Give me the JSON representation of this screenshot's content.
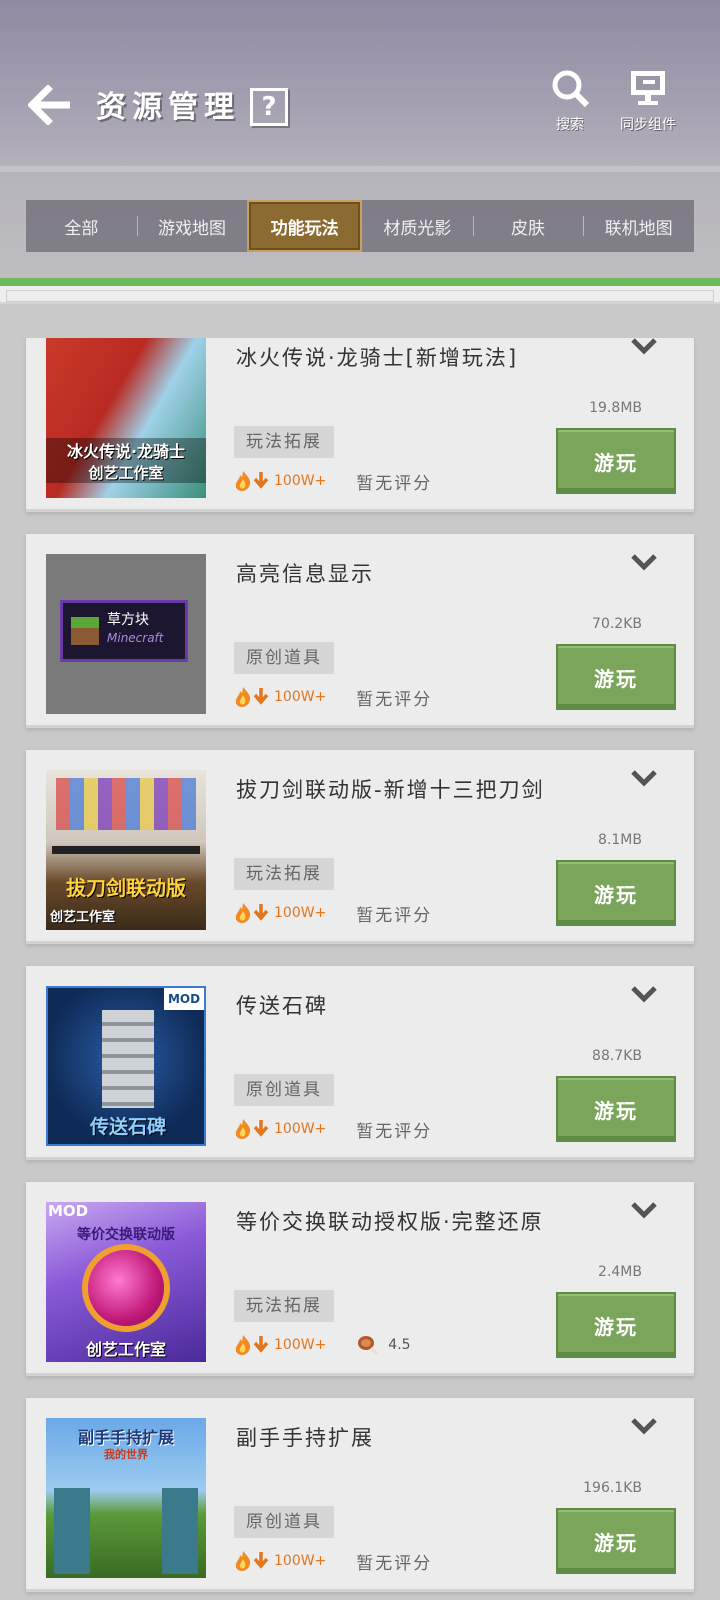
{
  "header": {
    "title": "资源管理",
    "help_label": "?",
    "search_label": "搜索",
    "sync_label": "同步组件"
  },
  "tabs": [
    {
      "label": "全部",
      "active": false
    },
    {
      "label": "游戏地图",
      "active": false
    },
    {
      "label": "功能玩法",
      "active": true
    },
    {
      "label": "材质光影",
      "active": false
    },
    {
      "label": "皮肤",
      "active": false
    },
    {
      "label": "联机地图",
      "active": false
    }
  ],
  "items": [
    {
      "title": "冰火传说·龙骑士[新增玩法]",
      "size": "19.8MB",
      "tag": "玩法拓展",
      "downloads": "100W+",
      "rating": "暂无评分",
      "play_label": "游玩",
      "thumb_lines": [
        "冰火传说·龙骑士",
        "创艺工作室"
      ]
    },
    {
      "title": "高亮信息显示",
      "size": "70.2KB",
      "tag": "原创道具",
      "downloads": "100W+",
      "rating": "暂无评分",
      "play_label": "游玩",
      "thumb_lines": [
        "草方块",
        "Minecraft"
      ]
    },
    {
      "title": "拔刀剑联动版-新增十三把刀剑",
      "size": "8.1MB",
      "tag": "玩法拓展",
      "downloads": "100W+",
      "rating": "暂无评分",
      "play_label": "游玩",
      "thumb_lines": [
        "拔刀剑联动版",
        "创艺工作室"
      ]
    },
    {
      "title": "传送石碑",
      "size": "88.7KB",
      "tag": "原创道具",
      "downloads": "100W+",
      "rating": "暂无评分",
      "play_label": "游玩",
      "thumb_lines": [
        "传送石碑",
        "MOD"
      ]
    },
    {
      "title": "等价交换联动授权版·完整还原",
      "size": "2.4MB",
      "tag": "玩法拓展",
      "downloads": "100W+",
      "rating": "4.5",
      "play_label": "游玩",
      "thumb_lines": [
        "等价交换联动版",
        "创艺工作室",
        "MOD"
      ]
    },
    {
      "title": "副手手持扩展",
      "size": "196.1KB",
      "tag": "原创道具",
      "downloads": "100W+",
      "rating": "暂无评分",
      "play_label": "游玩",
      "thumb_lines": [
        "副手手持扩展",
        "我的世界"
      ]
    }
  ],
  "colors": {
    "accent_green": "#7aa55a",
    "tab_active": "#8b6b32",
    "download_orange": "#e2761e"
  },
  "icons": {
    "back": "back-arrow-icon",
    "help": "help-icon",
    "search": "search-icon",
    "sync": "sync-components-icon",
    "expand": "chevron-down-icon",
    "downloads": "fire-download-icon",
    "rating": "meat-rating-icon"
  }
}
